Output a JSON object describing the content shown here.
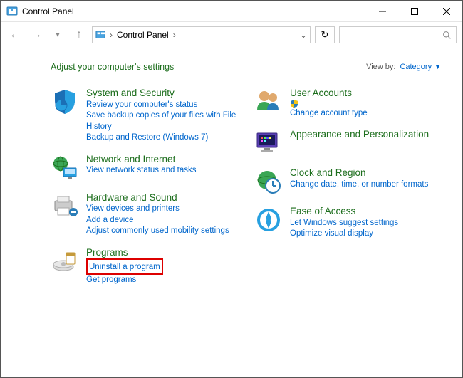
{
  "window": {
    "title": "Control Panel"
  },
  "address": {
    "location": "Control Panel"
  },
  "header": {
    "heading": "Adjust your computer's settings",
    "viewby_label": "View by:",
    "viewby_value": "Category"
  },
  "categories": {
    "left": [
      {
        "name": "System and Security",
        "links": [
          "Review your computer's status",
          "Save backup copies of your files with File History",
          "Backup and Restore (Windows 7)"
        ]
      },
      {
        "name": "Network and Internet",
        "links": [
          "View network status and tasks"
        ]
      },
      {
        "name": "Hardware and Sound",
        "links": [
          "View devices and printers",
          "Add a device",
          "Adjust commonly used mobility settings"
        ]
      },
      {
        "name": "Programs",
        "links": [
          "Uninstall a program",
          "Get programs"
        ],
        "highlight_index": 0
      }
    ],
    "right": [
      {
        "name": "User Accounts",
        "links": [
          "Change account type"
        ],
        "shield": [
          0
        ]
      },
      {
        "name": "Appearance and Personalization",
        "links": []
      },
      {
        "name": "Clock and Region",
        "links": [
          "Change date, time, or number formats"
        ]
      },
      {
        "name": "Ease of Access",
        "links": [
          "Let Windows suggest settings",
          "Optimize visual display"
        ]
      }
    ]
  }
}
